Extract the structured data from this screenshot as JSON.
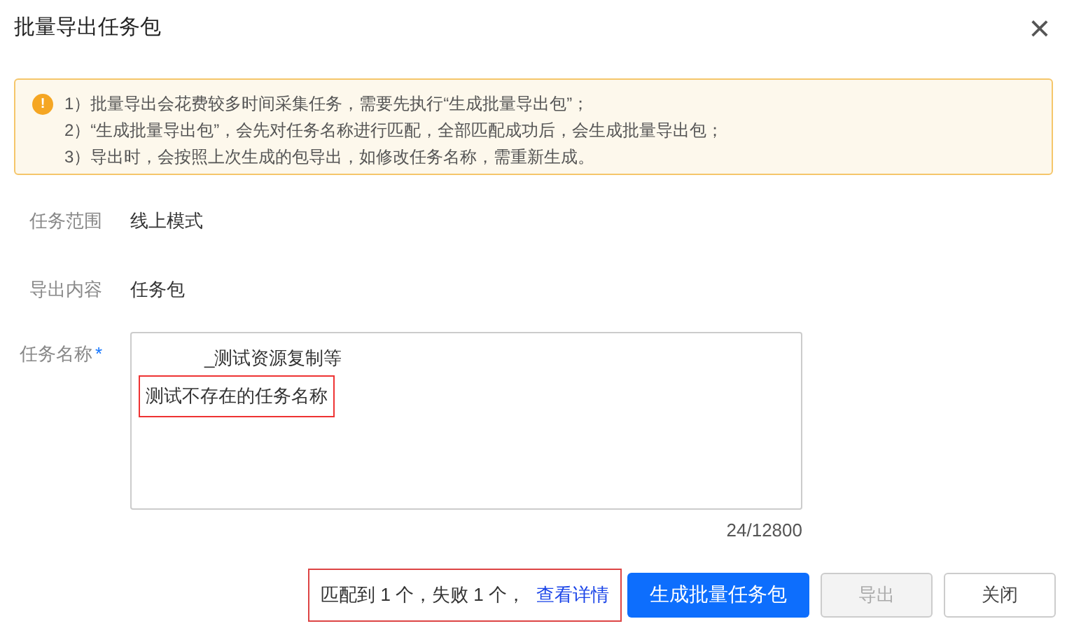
{
  "dialog": {
    "title": "批量导出任务包",
    "close": "×"
  },
  "notice": {
    "icon": "!",
    "lines": [
      "1）批量导出会花费较多时间采集任务，需要先执行“生成批量导出包”；",
      "2）“生成批量导出包”，会先对任务名称进行匹配，全部匹配成功后，会生成批量导出包；",
      "3）导出时，会按照上次生成的包导出，如修改任务名称，需重新生成。"
    ]
  },
  "fields": [
    {
      "label": "任务范围",
      "value": "线上模式"
    },
    {
      "label": "导出内容",
      "value": "任务包"
    }
  ],
  "task_names": {
    "label": "任务名称",
    "required_mark": "*",
    "lines": [
      {
        "text": "_测试资源复制等",
        "highlighted": false
      },
      {
        "text": "测试不存在的任务名称",
        "highlighted": true
      }
    ],
    "counter": "24/12800"
  },
  "footer": {
    "result": "匹配到 1 个，失败 1 个，",
    "link": "查看详情",
    "buttons": [
      {
        "label": "生成批量任务包",
        "kind": "primary",
        "disabled": false
      },
      {
        "label": "导出",
        "kind": "default",
        "disabled": true
      },
      {
        "label": "关闭",
        "kind": "default",
        "disabled": false
      }
    ]
  }
}
